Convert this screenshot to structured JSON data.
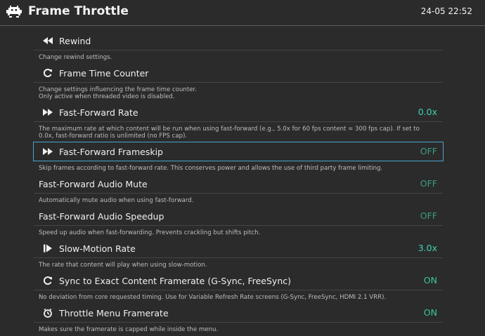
{
  "header": {
    "title": "Frame Throttle",
    "clock": "24-05 22:52"
  },
  "colors": {
    "background": "#2b2b2b",
    "accent": "#39c6a4",
    "selection": "#47a6cc"
  },
  "items": [
    {
      "icon": "rewind-icon",
      "label": "Rewind",
      "value": "",
      "desc": [
        "Change rewind settings."
      ]
    },
    {
      "icon": "refresh-icon",
      "label": "Frame Time Counter",
      "value": "",
      "desc": [
        "Change settings influencing the frame time counter.",
        "Only active when threaded video is disabled."
      ]
    },
    {
      "icon": "fast-forward-icon",
      "label": "Fast-Forward Rate",
      "value": "0.0x",
      "desc": [
        "The maximum rate at which content will be run when using fast-forward (e.g., 5.0x for 60 fps content = 300 fps cap). If set to",
        "0.0x, fast-forward ratio is unlimited (no FPS cap)."
      ]
    },
    {
      "icon": "fast-forward-icon",
      "label": "Fast-Forward Frameskip",
      "value": "OFF",
      "desc": [
        "Skip frames according to fast-forward rate. This conserves power and allows the use of third party frame limiting."
      ]
    },
    {
      "icon": "",
      "label": "Fast-Forward Audio Mute",
      "value": "OFF",
      "desc": [
        "Automatically mute audio when using fast-forward."
      ]
    },
    {
      "icon": "",
      "label": "Fast-Forward Audio Speedup",
      "value": "OFF",
      "desc": [
        "Speed up audio when fast-forwarding. Prevents crackling but shifts pitch."
      ]
    },
    {
      "icon": "slow-motion-icon",
      "label": "Slow-Motion Rate",
      "value": "3.0x",
      "desc": [
        "The rate that content will play when using slow-motion."
      ]
    },
    {
      "icon": "refresh-icon",
      "label": "Sync to Exact Content Framerate (G-Sync, FreeSync)",
      "value": "ON",
      "desc": [
        "No deviation from core requested timing. Use for Variable Refresh Rate screens (G-Sync, FreeSync, HDMI 2.1 VRR)."
      ]
    },
    {
      "icon": "timer-icon",
      "label": "Throttle Menu Framerate",
      "value": "ON",
      "desc": [
        "Makes sure the framerate is capped while inside the menu."
      ]
    }
  ]
}
